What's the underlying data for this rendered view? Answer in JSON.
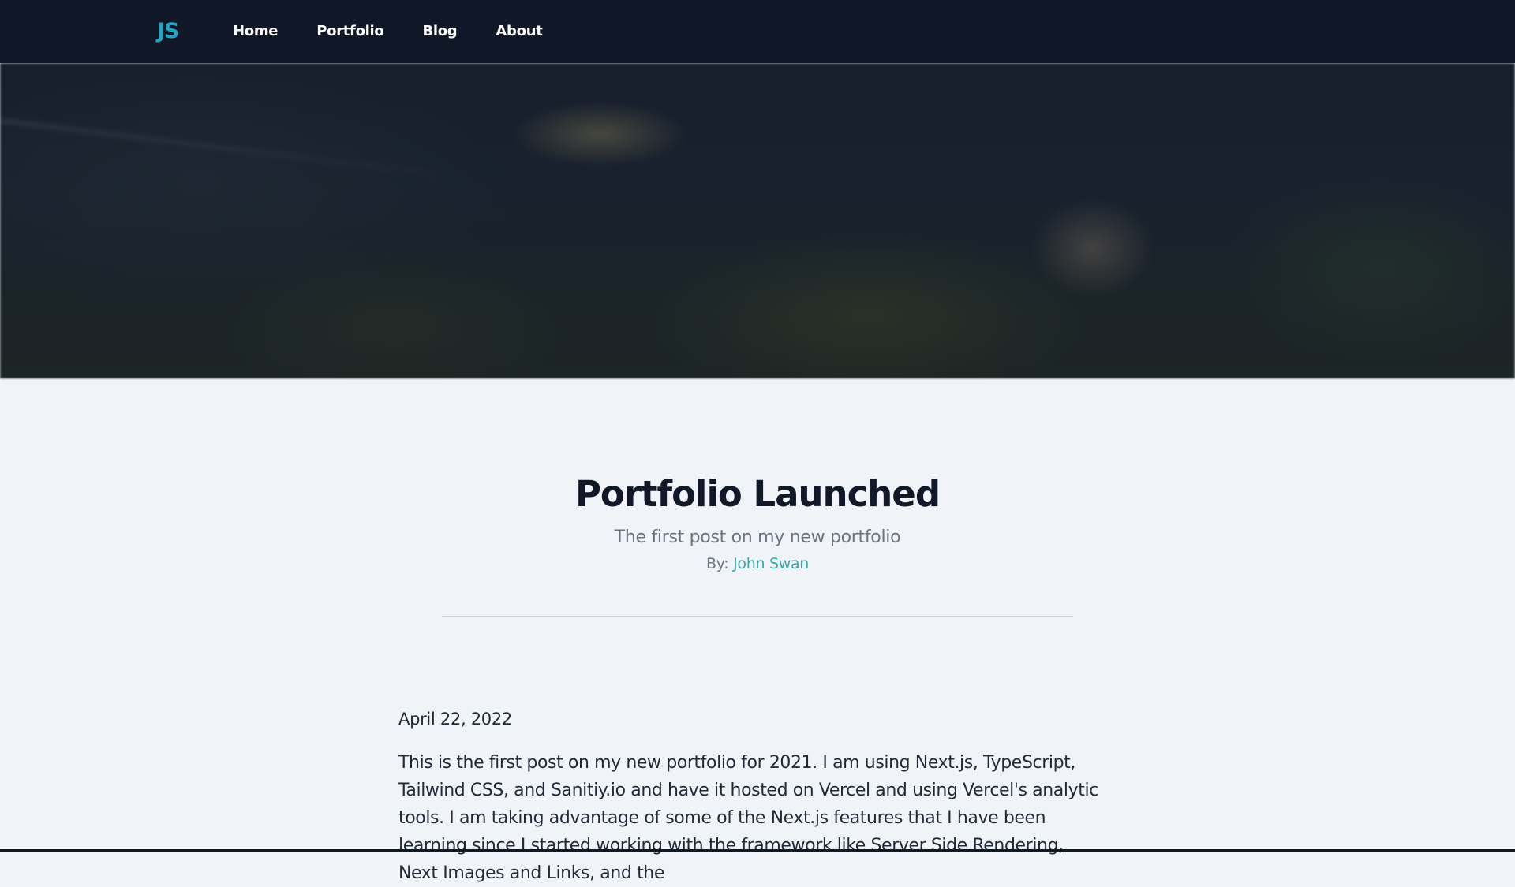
{
  "nav": {
    "logo": "JS",
    "links": [
      "Home",
      "Portfolio",
      "Blog",
      "About"
    ]
  },
  "hero": {
    "image": "blurred-nature-banner"
  },
  "article": {
    "title": "Portfolio Launched",
    "subtitle": "The first post on my new portfolio",
    "byline_prefix": "By: ",
    "author": "John Swan",
    "date": "April 22, 2022",
    "body": "This is the first post on my new portfolio for 2021. I am using Next.js, TypeScript, Tailwind CSS, and Sanitiy.io and have it hosted on Vercel and using Vercel's analytic tools. I am taking advantage of some of the Next.js features that I have been learning since I started working with the framework like Server Side Rendering, Next Images and Links, and the"
  },
  "colors": {
    "navbar_bg": "#101828",
    "logo": "#22a6c4",
    "page_bg": "#f0f4f8",
    "title": "#111827",
    "muted": "#6b7280",
    "author_link": "#3aa6a6"
  }
}
